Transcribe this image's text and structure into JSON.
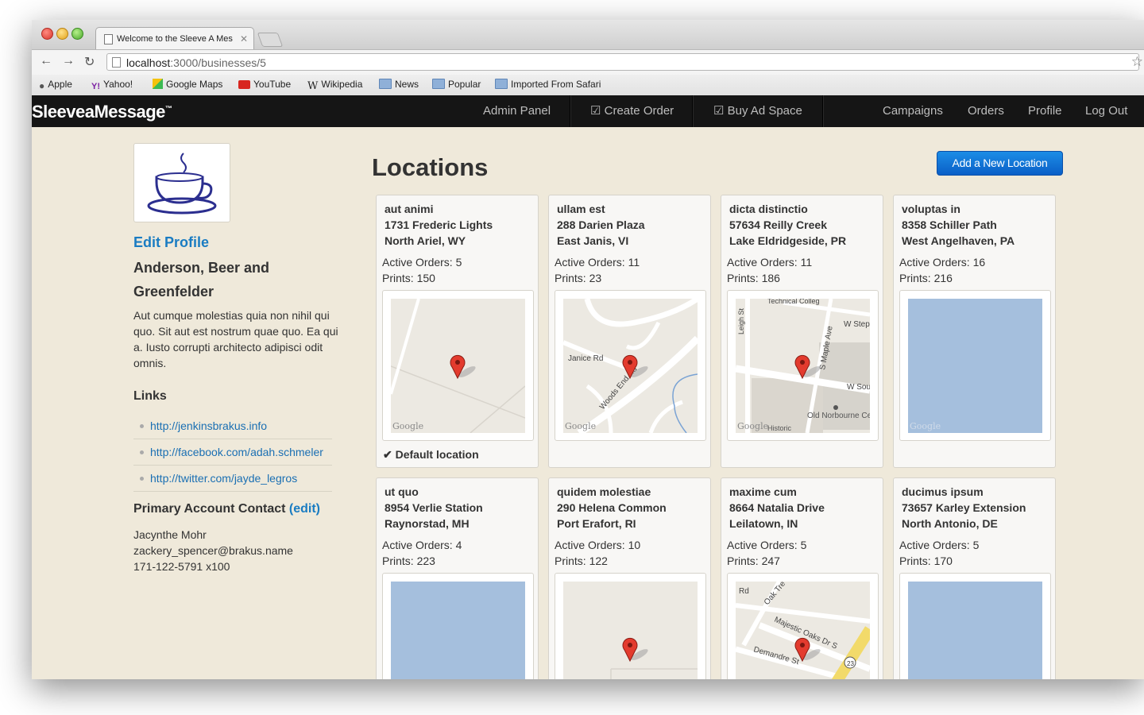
{
  "browser": {
    "tab_title": "Welcome to the Sleeve A Mes",
    "url_host": "localhost",
    "url_path": ":3000/businesses/5",
    "bookmarks": [
      "Apple",
      "Yahoo!",
      "Google Maps",
      "YouTube",
      "Wikipedia",
      "News",
      "Popular",
      "Imported From Safari"
    ]
  },
  "navbar": {
    "logo": "SleeveaMessage",
    "logo_tm": "™",
    "items": [
      "Admin Panel",
      "Create Order",
      "Buy Ad Space",
      "Campaigns",
      "Orders",
      "Profile",
      "Log Out"
    ]
  },
  "profile": {
    "edit_label": "Edit Profile",
    "business_name": "Anderson, Beer and Greenfelder",
    "description": "Aut cumque molestias quia non nihil qui quo. Sit aut est nostrum quae quo. Ea qui a. Iusto corrupti architecto adipisci odit omnis.",
    "links_heading": "Links",
    "links": [
      "http://jenkinsbrakus.info",
      "http://facebook.com/adah.schmeler",
      "http://twitter.com/jayde_legros"
    ],
    "contact_heading": "Primary Account Contact",
    "contact_edit": "(edit)",
    "contact_name": "Jacynthe Mohr",
    "contact_email": "zackery_spencer@brakus.name",
    "contact_phone": "171-122-5791 x100"
  },
  "locations": {
    "heading": "Locations",
    "add_button": "Add a New Location",
    "map_credit": "Google",
    "default_label": "Default location",
    "items": [
      {
        "name": "aut animi",
        "street": "1731 Frederic Lights",
        "city": "North Ariel, WY",
        "orders": "Active Orders: 5",
        "prints": "Prints: 150"
      },
      {
        "name": "ullam est",
        "street": "288 Darien Plaza",
        "city": "East Janis, VI",
        "orders": "Active Orders: 11",
        "prints": "Prints: 23"
      },
      {
        "name": "dicta distinctio",
        "street": "57634 Reilly Creek",
        "city": "Lake Eldridgeside, PR",
        "orders": "Active Orders: 11",
        "prints": "Prints: 186"
      },
      {
        "name": "voluptas in",
        "street": "8358 Schiller Path",
        "city": "West Angelhaven, PA",
        "orders": "Active Orders: 16",
        "prints": "Prints: 216"
      },
      {
        "name": "ut quo",
        "street": "8954 Verlie Station",
        "city": "Raynorstad, MH",
        "orders": "Active Orders: 4",
        "prints": "Prints: 223"
      },
      {
        "name": "quidem molestiae",
        "street": "290 Helena Common",
        "city": "Port Erafort, RI",
        "orders": "Active Orders: 10",
        "prints": "Prints: 122"
      },
      {
        "name": "maxime cum",
        "street": "8664 Natalia Drive",
        "city": "Leilatown, IN",
        "orders": "Active Orders: 5",
        "prints": "Prints: 247"
      },
      {
        "name": "ducimus ipsum",
        "street": "73657 Karley Extension",
        "city": "North Antonio, DE",
        "orders": "Active Orders: 5",
        "prints": "Prints: 170"
      }
    ],
    "map_labels": {
      "janice_rd": "Janice Rd",
      "woods_end_rd": "Woods End Rd",
      "w_step": "W Step",
      "s_maple_ave": "S Maple Ave",
      "w_sou": "W Sou",
      "cemetery": "Old Norbourne Cemetery",
      "historic": "Historic",
      "leigh_st": "Leigh St",
      "technical_colleg": "Technical Colleg",
      "majestic_oaks": "Majestic Oaks Dr S",
      "demandre_st": "Demandre St",
      "oak_tre": "Oak Tre",
      "rd": "Rd",
      "route_23": "23"
    }
  },
  "colors": {
    "navbar_bg": "#151515",
    "link": "#1a7cc2",
    "button": "#0a5fc7",
    "page_bg": "#efe9da",
    "ocean_tile": "#a5bfdd"
  }
}
